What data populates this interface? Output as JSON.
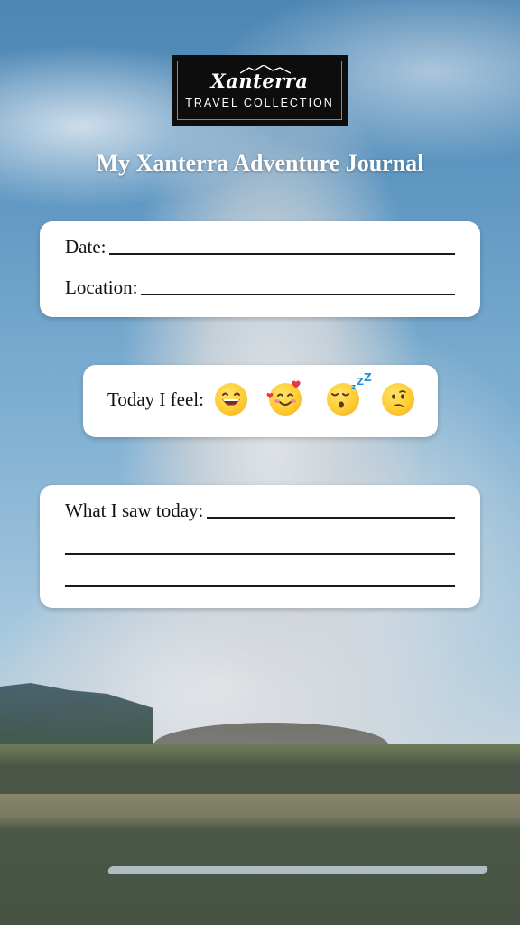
{
  "logo": {
    "brand": "Xanterra",
    "tagline": "TRAVEL COLLECTION"
  },
  "title": "My Xanterra Adventure Journal",
  "info_card": {
    "date_label": "Date:",
    "location_label": "Location:"
  },
  "mood_card": {
    "label": "Today I feel:",
    "emojis": [
      "laughing-face-icon",
      "smiling-face-with-hearts-icon",
      "sleeping-face-icon",
      "confused-face-icon"
    ]
  },
  "saw_card": {
    "label": "What I saw today:"
  },
  "colors": {
    "card": "#ffffff",
    "logo_bg": "#0d0d0d",
    "emoji_yellow": "#ffcc33"
  }
}
